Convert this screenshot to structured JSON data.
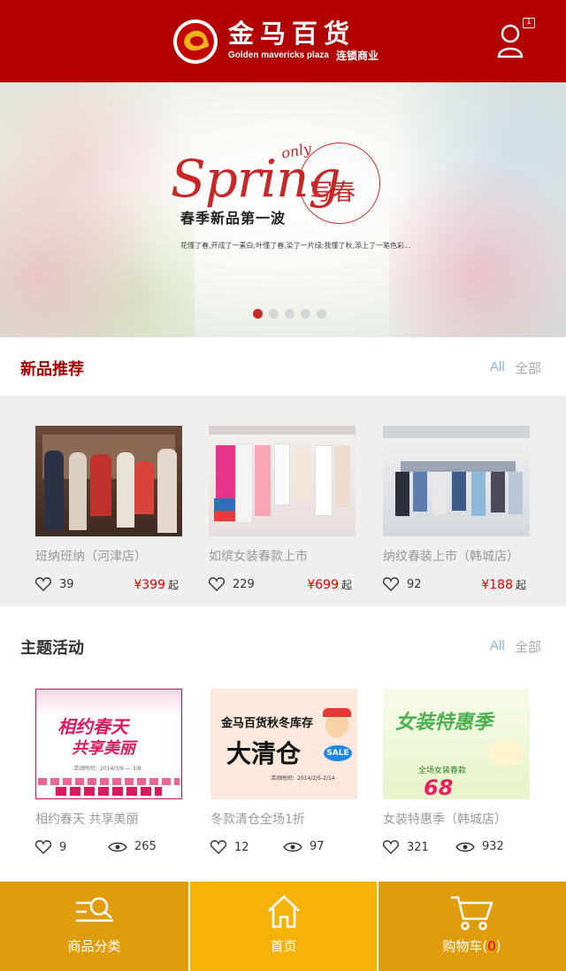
{
  "header": {
    "brand_cn": "金马百货",
    "brand_en": "Golden mavericks plaza",
    "brand_sub": "连锁商业",
    "message_count": "1"
  },
  "banner": {
    "title_en": "Spring",
    "title_script": "only",
    "title_cn": "写春",
    "heading": "春季新品第一波",
    "subtitle": "花懂了春,开成了一素白;叶懂了春,染了一片绿;我懂了秋,添上了一笔色彩...",
    "slide_count": 5,
    "active_slide": 1
  },
  "new_products": {
    "title": "新品推荐",
    "all_en": "All",
    "all_cn": "全部",
    "items": [
      {
        "name": "班纳班纳（河津店）",
        "likes": "39",
        "price": "¥399",
        "suffix": "起"
      },
      {
        "name": "如缤女装春款上市",
        "likes": "229",
        "price": "¥699",
        "suffix": "起"
      },
      {
        "name": "纳纹春装上市（韩城店）",
        "likes": "92",
        "price": "¥188",
        "suffix": "起"
      }
    ]
  },
  "activities": {
    "title": "主题活动",
    "all_en": "All",
    "all_cn": "全部",
    "items": [
      {
        "name": "相约春天 共享美丽",
        "likes": "9",
        "views": "265",
        "poster_title": "相约春天",
        "poster_sub": "共享美丽",
        "poster_date": "活动时间：2014/3/6 — 3/8"
      },
      {
        "name": "冬款清仓全场1折",
        "likes": "12",
        "views": "97",
        "poster_top": "金马百货秋冬库存",
        "poster_title": "大清仓",
        "poster_sale": "SALE",
        "poster_date": "活动时间：2014/2/5-2/14"
      },
      {
        "name": "女装特惠季（韩城店）",
        "likes": "321",
        "views": "932",
        "poster_title": "女装特惠季",
        "poster_sub": "全场女装春款",
        "poster_num": "68"
      }
    ]
  },
  "bottom_nav": {
    "category": "商品分类",
    "home": "首页",
    "cart": "购物车",
    "cart_count": "0"
  },
  "colors": {
    "brand_red": "#b20000",
    "nav_gold": "#df9c0c",
    "nav_active": "#f5b309",
    "price_red": "#dd0000"
  }
}
